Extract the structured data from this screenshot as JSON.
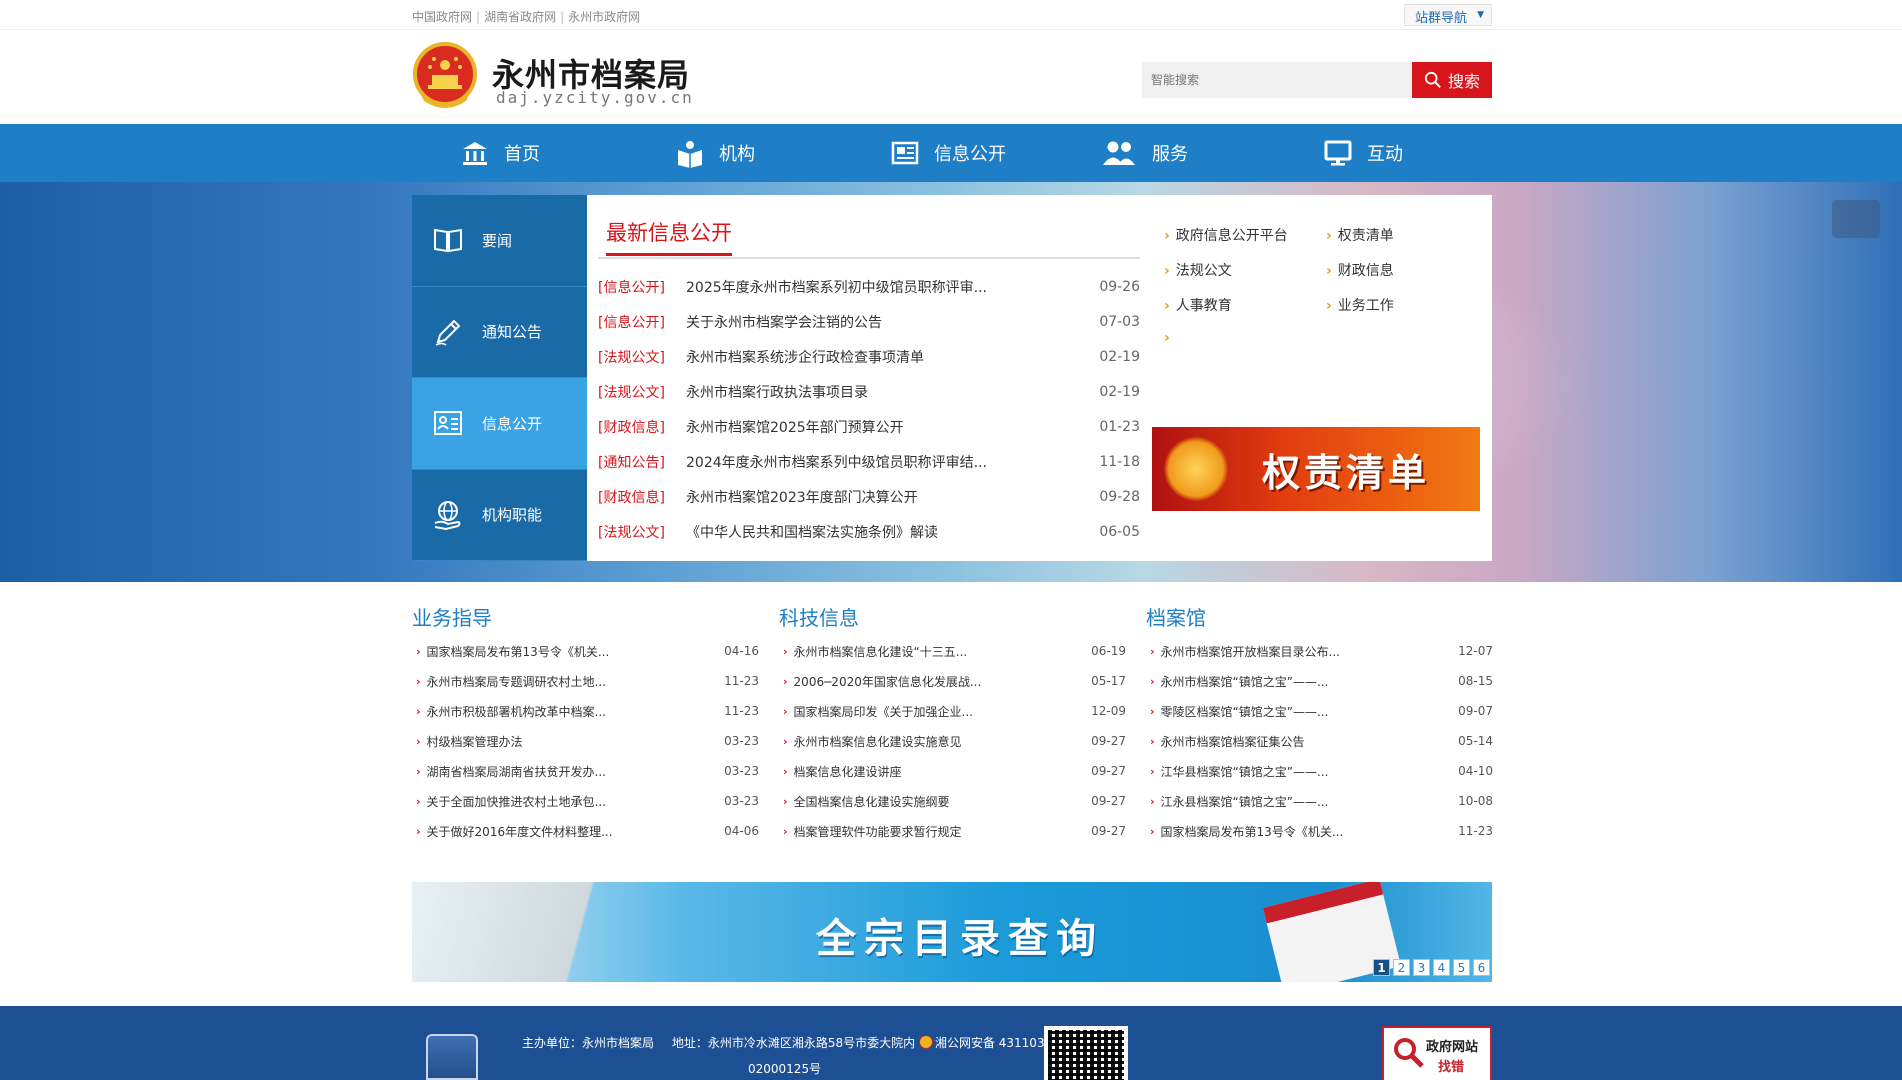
{
  "top_links": [
    "中国政府网",
    "湖南省政府网",
    "永州市政府网"
  ],
  "site_nav": {
    "label": "站群导航"
  },
  "header": {
    "title": "永州市档案局",
    "domain": "daj.yzcity.gov.cn",
    "search_placeholder": "智能搜索",
    "search_button": "搜索"
  },
  "nav": [
    {
      "label": "首页",
      "icon": "bank-icon"
    },
    {
      "label": "机构",
      "icon": "book-icon"
    },
    {
      "label": "信息公开",
      "icon": "newspaper-icon"
    },
    {
      "label": "服务",
      "icon": "people-icon"
    },
    {
      "label": "互动",
      "icon": "monitor-icon"
    }
  ],
  "side_tabs": [
    {
      "label": "要闻",
      "icon": "book-open-icon",
      "active": false
    },
    {
      "label": "通知公告",
      "icon": "pen-icon",
      "active": false
    },
    {
      "label": "信息公开",
      "icon": "id-card-icon",
      "active": true
    },
    {
      "label": "机构职能",
      "icon": "globe-hand-icon",
      "active": false
    }
  ],
  "news": {
    "title": "最新信息公开",
    "items": [
      {
        "tag": "[信息公开]",
        "text": "2025年度永州市档案系列初中级馆员职称评审...",
        "date": "09-26"
      },
      {
        "tag": "[信息公开]",
        "text": "关于永州市档案学会注销的公告",
        "date": "07-03"
      },
      {
        "tag": "[法规公文]",
        "text": "永州市档案系统涉企行政检查事项清单",
        "date": "02-19"
      },
      {
        "tag": "[法规公文]",
        "text": "永州市档案行政执法事项目录",
        "date": "02-19"
      },
      {
        "tag": "[财政信息]",
        "text": "永州市档案馆2025年部门预算公开",
        "date": "01-23"
      },
      {
        "tag": "[通知公告]",
        "text": "2024年度永州市档案系列中级馆员职称评审结...",
        "date": "11-18"
      },
      {
        "tag": "[财政信息]",
        "text": "永州市档案馆2023年度部门决算公开",
        "date": "09-28"
      },
      {
        "tag": "[法规公文]",
        "text": "《中华人民共和国档案法实施条例》解读",
        "date": "06-05"
      }
    ]
  },
  "quick_links": [
    "政府信息公开平台",
    "权责清单",
    "法规公文",
    "财政信息",
    "人事教育",
    "业务工作",
    ""
  ],
  "qd_banner": {
    "text": "权责清单"
  },
  "columns": [
    {
      "title": "业务指导",
      "items": [
        {
          "text": "国家档案局发布第13号令《机关...",
          "date": "04-16"
        },
        {
          "text": "永州市档案局专题调研农村土地...",
          "date": "11-23"
        },
        {
          "text": "永州市积极部署机构改革中档案...",
          "date": "11-23"
        },
        {
          "text": "村级档案管理办法",
          "date": "03-23"
        },
        {
          "text": "湖南省档案局湖南省扶贫开发办...",
          "date": "03-23"
        },
        {
          "text": "关于全面加快推进农村土地承包...",
          "date": "03-23"
        },
        {
          "text": "关于做好2016年度文件材料整理...",
          "date": "04-06"
        }
      ]
    },
    {
      "title": "科技信息",
      "items": [
        {
          "text": "永州市档案信息化建设“十三五...",
          "date": "06-19"
        },
        {
          "text": "2006─2020年国家信息化发展战...",
          "date": "05-17"
        },
        {
          "text": "国家档案局印发《关于加强企业...",
          "date": "12-09"
        },
        {
          "text": "永州市档案信息化建设实施意见",
          "date": "09-27"
        },
        {
          "text": "档案信息化建设讲座",
          "date": "09-27"
        },
        {
          "text": "全国档案信息化建设实施纲要",
          "date": "09-27"
        },
        {
          "text": "档案管理软件功能要求暂行规定",
          "date": "09-27"
        }
      ]
    },
    {
      "title": "档案馆",
      "items": [
        {
          "text": "永州市档案馆开放档案目录公布...",
          "date": "12-07"
        },
        {
          "text": "永州市档案馆“镇馆之宝”——...",
          "date": "08-15"
        },
        {
          "text": "零陵区档案馆“镇馆之宝”——...",
          "date": "09-07"
        },
        {
          "text": "永州市档案馆档案征集公告",
          "date": "05-14"
        },
        {
          "text": "江华县档案馆“镇馆之宝”——...",
          "date": "04-10"
        },
        {
          "text": "江永县档案馆“镇馆之宝”——...",
          "date": "10-08"
        },
        {
          "text": "国家档案局发布第13号令《机关...",
          "date": "11-23"
        }
      ]
    }
  ],
  "query_banner": {
    "text": "全宗目录查询",
    "pages": [
      "1",
      "2",
      "3",
      "4",
      "5",
      "6"
    ],
    "current_page": "1"
  },
  "footer": {
    "host": "主办单位：永州市档案局",
    "address": "地址：永州市冷水滩区湘永路58号市委大院内",
    "police": "湘公网安备 431103",
    "police_cont": "02000125号",
    "err_l1": "政府网站",
    "err_l2": "找错"
  }
}
